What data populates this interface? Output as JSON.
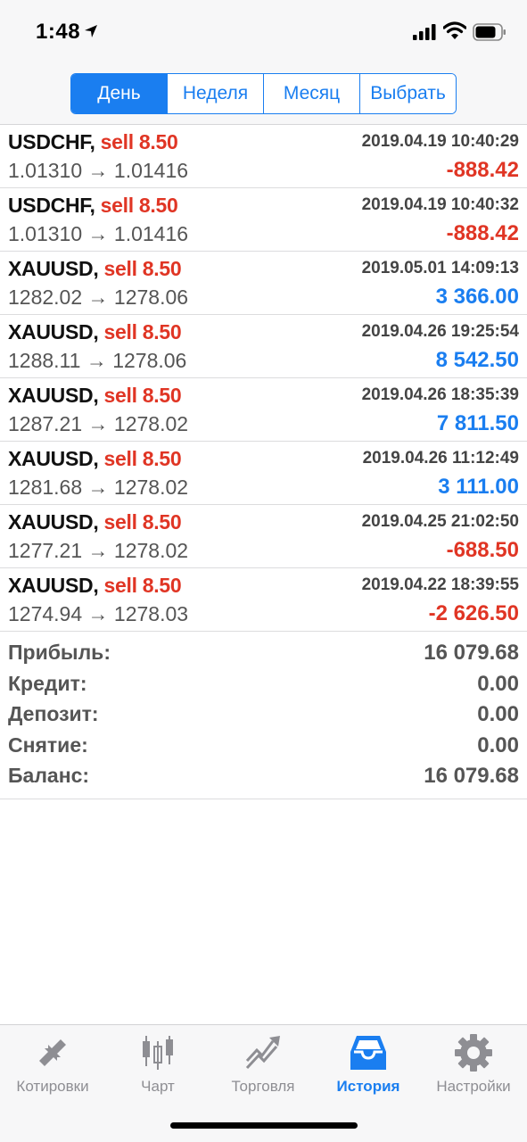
{
  "status_bar": {
    "time": "1:48"
  },
  "tabs_period": [
    {
      "label": "День",
      "active": true
    },
    {
      "label": "Неделя",
      "active": false
    },
    {
      "label": "Месяц",
      "active": false
    },
    {
      "label": "Выбрать",
      "active": false
    }
  ],
  "deals": [
    {
      "symbol": "USDCHF,",
      "action": "sell 8.50",
      "date": "2019.04.19 10:40:29",
      "prices": "1.01310 → 1.01416",
      "profit": "-888.42",
      "profit_sign": "neg"
    },
    {
      "symbol": "USDCHF,",
      "action": "sell 8.50",
      "date": "2019.04.19 10:40:32",
      "prices": "1.01310 → 1.01416",
      "profit": "-888.42",
      "profit_sign": "neg"
    },
    {
      "symbol": "XAUUSD,",
      "action": "sell 8.50",
      "date": "2019.05.01 14:09:13",
      "prices": "1282.02 → 1278.06",
      "profit": "3 366.00",
      "profit_sign": "pos"
    },
    {
      "symbol": "XAUUSD,",
      "action": "sell 8.50",
      "date": "2019.04.26 19:25:54",
      "prices": "1288.11 → 1278.06",
      "profit": "8 542.50",
      "profit_sign": "pos"
    },
    {
      "symbol": "XAUUSD,",
      "action": "sell 8.50",
      "date": "2019.04.26 18:35:39",
      "prices": "1287.21 → 1278.02",
      "profit": "7 811.50",
      "profit_sign": "pos"
    },
    {
      "symbol": "XAUUSD,",
      "action": "sell 8.50",
      "date": "2019.04.26 11:12:49",
      "prices": "1281.68 → 1278.02",
      "profit": "3 111.00",
      "profit_sign": "pos"
    },
    {
      "symbol": "XAUUSD,",
      "action": "sell 8.50",
      "date": "2019.04.25 21:02:50",
      "prices": "1277.21 → 1278.02",
      "profit": "-688.50",
      "profit_sign": "neg"
    },
    {
      "symbol": "XAUUSD,",
      "action": "sell 8.50",
      "date": "2019.04.22 18:39:55",
      "prices": "1274.94 → 1278.03",
      "profit": "-2 626.50",
      "profit_sign": "neg"
    }
  ],
  "summary": [
    {
      "label": "Прибыль:",
      "value": "16 079.68"
    },
    {
      "label": "Кредит:",
      "value": "0.00"
    },
    {
      "label": "Депозит:",
      "value": "0.00"
    },
    {
      "label": "Снятие:",
      "value": "0.00"
    },
    {
      "label": "Баланс:",
      "value": "16 079.68"
    }
  ],
  "tab_bar": [
    {
      "label": "Котировки",
      "icon": "quotes-arrows-icon",
      "active": false
    },
    {
      "label": "Чарт",
      "icon": "candlestick-chart-icon",
      "active": false
    },
    {
      "label": "Торговля",
      "icon": "trade-trend-icon",
      "active": false
    },
    {
      "label": "История",
      "icon": "history-inbox-icon",
      "active": true
    },
    {
      "label": "Настройки",
      "icon": "gear-icon",
      "active": false
    }
  ],
  "colors": {
    "accent": "#1a7ef0",
    "negative": "#e03524",
    "inactive": "#8e8e93"
  }
}
